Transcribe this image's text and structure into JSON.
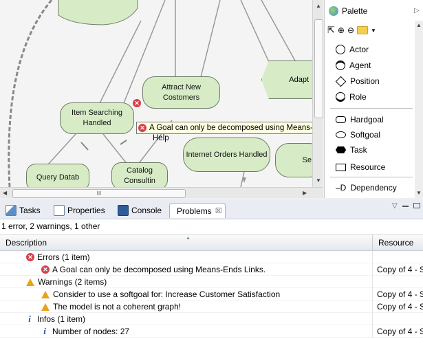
{
  "diagram": {
    "nodes": [
      {
        "id": "attract",
        "label": "Attract New Costomers"
      },
      {
        "id": "item",
        "label": "Item Searching Handled"
      },
      {
        "id": "internet",
        "label": "Internet Orders Handled"
      },
      {
        "id": "query",
        "label": "Query Datab"
      },
      {
        "id": "catalog",
        "label": "Catalog Consultin"
      },
      {
        "id": "adapt",
        "label": "Adapt"
      },
      {
        "id": "se",
        "label": "Se"
      },
      {
        "id": "help",
        "label": "Help"
      }
    ],
    "tooltip": "A Goal can only be decomposed using Means-Ends Links.",
    "hscroll_grip": "III"
  },
  "palette": {
    "title": "Palette",
    "items": [
      {
        "label": "Actor",
        "icon": "actor-icon"
      },
      {
        "label": "Agent",
        "icon": "agent-icon"
      },
      {
        "label": "Position",
        "icon": "position-icon"
      },
      {
        "label": "Role",
        "icon": "role-icon"
      },
      {
        "label": "Hardgoal",
        "icon": "hardgoal-icon"
      },
      {
        "label": "Softgoal",
        "icon": "softgoal-icon"
      },
      {
        "label": "Task",
        "icon": "task-icon"
      },
      {
        "label": "Resource",
        "icon": "resource-icon"
      },
      {
        "label": "Dependency",
        "icon": "dependency-icon"
      }
    ]
  },
  "views": {
    "tabs": [
      {
        "label": "Tasks"
      },
      {
        "label": "Properties"
      },
      {
        "label": "Console"
      },
      {
        "label": "Problems",
        "close": "☒"
      }
    ]
  },
  "problems": {
    "summary": "1 error, 2 warnings, 1 other",
    "columns": {
      "description": "Description",
      "resource": "Resource"
    },
    "rows": [
      {
        "type": "error",
        "level": 1,
        "text": "Errors (1 item)",
        "resource": ""
      },
      {
        "type": "error",
        "level": 2,
        "text": "A Goal can only be decomposed using Means-Ends Links.",
        "resource": "Copy of 4 - S"
      },
      {
        "type": "warning",
        "level": 1,
        "text": "Warnings (2 items)",
        "resource": ""
      },
      {
        "type": "warning",
        "level": 2,
        "text": "Consider to use a softgoal for: Increase Customer Satisfaction",
        "resource": "Copy of 4 - S"
      },
      {
        "type": "warning",
        "level": 2,
        "text": "The model is not a coherent graph!",
        "resource": "Copy of 4 - S"
      },
      {
        "type": "info",
        "level": 1,
        "text": "Infos (1 item)",
        "resource": ""
      },
      {
        "type": "info",
        "level": 2,
        "text": "Number of nodes: 27",
        "resource": "Copy of 4 - S"
      }
    ]
  },
  "colors": {
    "goal_fill": "#d6ebc6",
    "error": "#d8404a",
    "warning": "#e8a317",
    "info": "#1f4fa8"
  }
}
